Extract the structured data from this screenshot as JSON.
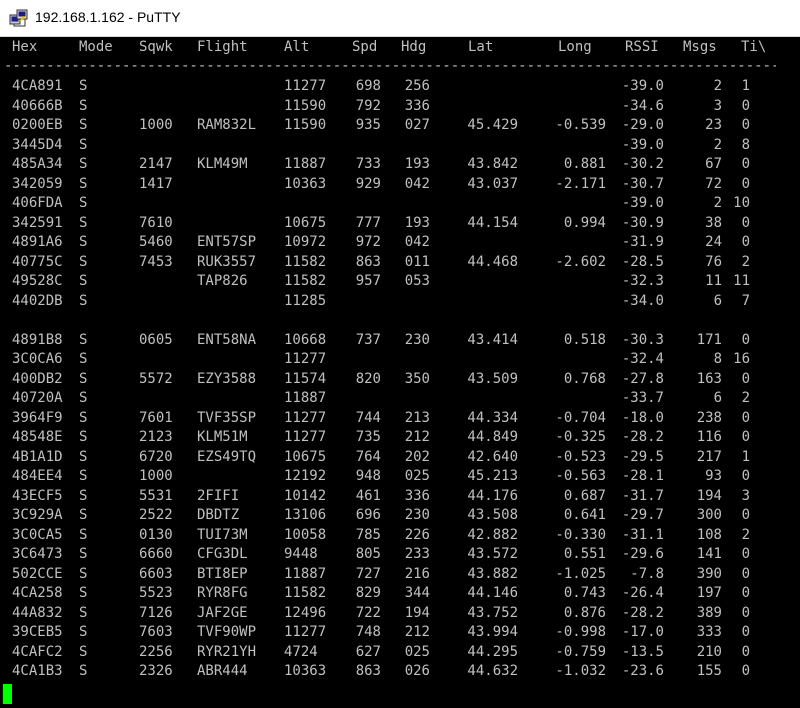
{
  "window": {
    "title": "192.168.1.162 - PuTTY",
    "icon": "putty-icon",
    "colors": {
      "background": "#000000",
      "text": "#c0c0c0",
      "cursor": "#00ff00"
    }
  },
  "table": {
    "headers": [
      "Hex",
      "Mode",
      "Sqwk",
      "Flight",
      "Alt",
      "Spd",
      "Hdg",
      "Lat",
      "Long",
      "RSSI",
      "Msgs",
      "Ti\\"
    ],
    "separator": "--------------------------------------------------------------------------------------------------------------",
    "rows": [
      [
        "4CA891",
        "S",
        "",
        "",
        "11277",
        "698",
        "256",
        "",
        "",
        "-39.0",
        "2",
        "1"
      ],
      [
        "40666B",
        "S",
        "",
        "",
        "11590",
        "792",
        "336",
        "",
        "",
        "-34.6",
        "3",
        "0"
      ],
      [
        "0200EB",
        "S",
        "1000",
        "RAM832L",
        "11590",
        "935",
        "027",
        "45.429",
        "-0.539",
        "-29.0",
        "23",
        "0"
      ],
      [
        "3445D4",
        "S",
        "",
        "",
        "",
        "",
        "",
        "",
        "",
        "-39.0",
        "2",
        "8"
      ],
      [
        "485A34",
        "S",
        "2147",
        "KLM49M",
        "11887",
        "733",
        "193",
        "43.842",
        "0.881",
        "-30.2",
        "67",
        "0"
      ],
      [
        "342059",
        "S",
        "1417",
        "",
        "10363",
        "929",
        "042",
        "43.037",
        "-2.171",
        "-30.7",
        "72",
        "0"
      ],
      [
        "406FDA",
        "S",
        "",
        "",
        "",
        "",
        "",
        "",
        "",
        "-39.0",
        "2",
        "10"
      ],
      [
        "342591",
        "S",
        "7610",
        "",
        "10675",
        "777",
        "193",
        "44.154",
        "0.994",
        "-30.9",
        "38",
        "0"
      ],
      [
        "4891A6",
        "S",
        "5460",
        "ENT57SP",
        "10972",
        "972",
        "042",
        "",
        "",
        "-31.9",
        "24",
        "0"
      ],
      [
        "40775C",
        "S",
        "7453",
        "RUK3557",
        "11582",
        "863",
        "011",
        "44.468",
        "-2.602",
        "-28.5",
        "76",
        "2"
      ],
      [
        "49528C",
        "S",
        "",
        "TAP826",
        "11582",
        "957",
        "053",
        "",
        "",
        "-32.3",
        "11",
        "11"
      ],
      [
        "4402DB",
        "S",
        "",
        "",
        "11285",
        "",
        "",
        "",
        "",
        "-34.0",
        "6",
        "7"
      ],
      null,
      [
        "4891B8",
        "S",
        "0605",
        "ENT58NA",
        "10668",
        "737",
        "230",
        "43.414",
        "0.518",
        "-30.3",
        "171",
        "0"
      ],
      [
        "3C0CA6",
        "S",
        "",
        "",
        "11277",
        "",
        "",
        "",
        "",
        "-32.4",
        "8",
        "16"
      ],
      [
        "400DB2",
        "S",
        "5572",
        "EZY3588",
        "11574",
        "820",
        "350",
        "43.509",
        "0.768",
        "-27.8",
        "163",
        "0"
      ],
      [
        "40720A",
        "S",
        "",
        "",
        "11887",
        "",
        "",
        "",
        "",
        "-33.7",
        "6",
        "2"
      ],
      [
        "3964F9",
        "S",
        "7601",
        "TVF35SP",
        "11277",
        "744",
        "213",
        "44.334",
        "-0.704",
        "-18.0",
        "238",
        "0"
      ],
      [
        "48548E",
        "S",
        "2123",
        "KLM51M",
        "11277",
        "735",
        "212",
        "44.849",
        "-0.325",
        "-28.2",
        "116",
        "0"
      ],
      [
        "4B1A1D",
        "S",
        "6720",
        "EZS49TQ",
        "10675",
        "764",
        "202",
        "42.640",
        "-0.523",
        "-29.5",
        "217",
        "1"
      ],
      [
        "484EE4",
        "S",
        "1000",
        "",
        "12192",
        "948",
        "025",
        "45.213",
        "-0.563",
        "-28.1",
        "93",
        "0"
      ],
      [
        "43ECF5",
        "S",
        "5531",
        "2FIFI",
        "10142",
        "461",
        "336",
        "44.176",
        "0.687",
        "-31.7",
        "194",
        "3"
      ],
      [
        "3C929A",
        "S",
        "2522",
        "DBDTZ",
        "13106",
        "696",
        "230",
        "43.508",
        "0.641",
        "-29.7",
        "300",
        "0"
      ],
      [
        "3C0CA5",
        "S",
        "0130",
        "TUI73M",
        "10058",
        "785",
        "226",
        "42.882",
        "-0.330",
        "-31.1",
        "108",
        "2"
      ],
      [
        "3C6473",
        "S",
        "6660",
        "CFG3DL",
        "9448",
        "805",
        "233",
        "43.572",
        "0.551",
        "-29.6",
        "141",
        "0"
      ],
      [
        "502CCE",
        "S",
        "6603",
        "BTI8EP",
        "11887",
        "727",
        "216",
        "43.882",
        "-1.025",
        "-7.8",
        "390",
        "0"
      ],
      [
        "4CA258",
        "S",
        "5523",
        "RYR8FG",
        "11582",
        "829",
        "344",
        "44.146",
        "0.743",
        "-26.4",
        "197",
        "0"
      ],
      [
        "44A832",
        "S",
        "7126",
        "JAF2GE",
        "12496",
        "722",
        "194",
        "43.752",
        "0.876",
        "-28.2",
        "389",
        "0"
      ],
      [
        "39CEB5",
        "S",
        "7603",
        "TVF90WP",
        "11277",
        "748",
        "212",
        "43.994",
        "-0.998",
        "-17.0",
        "333",
        "0"
      ],
      [
        "4CAFC2",
        "S",
        "2256",
        "RYR21YH",
        "4724",
        "627",
        "025",
        "44.295",
        "-0.759",
        "-13.5",
        "210",
        "0"
      ],
      [
        "4CA1B3",
        "S",
        "2326",
        "ABR444",
        "10363",
        "863",
        "026",
        "44.632",
        "-1.032",
        "-23.6",
        "155",
        "0"
      ]
    ]
  }
}
